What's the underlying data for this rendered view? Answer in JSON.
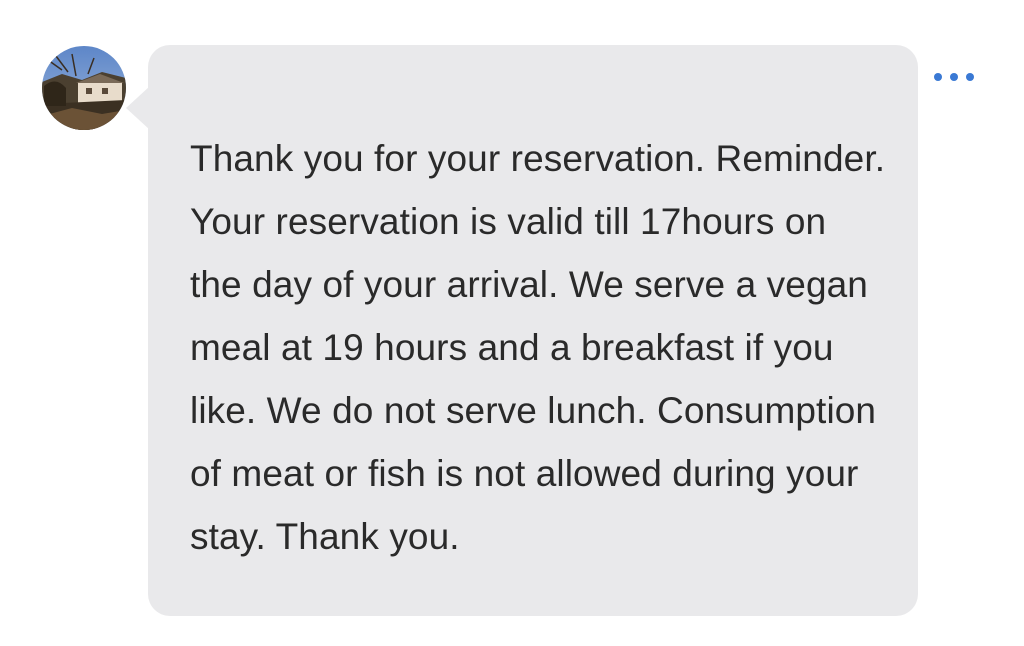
{
  "sender": {
    "avatar_icon": "house-landscape-photo-icon"
  },
  "message": {
    "text": "Thank you for your reservation. Reminder. Your reservation is valid till 17hours on the day of your arrival. We serve a vegan meal at 19 hours and a breakfast if you like. We do not serve lunch. Consumption of meat or fish is not allowed during your stay. Thank you.",
    "bubble_color": "#e9e9eb",
    "text_color": "#2a2a2a"
  },
  "actions": {
    "more_icon": "more-horizontal-icon",
    "accent_color": "#3a79d4"
  }
}
